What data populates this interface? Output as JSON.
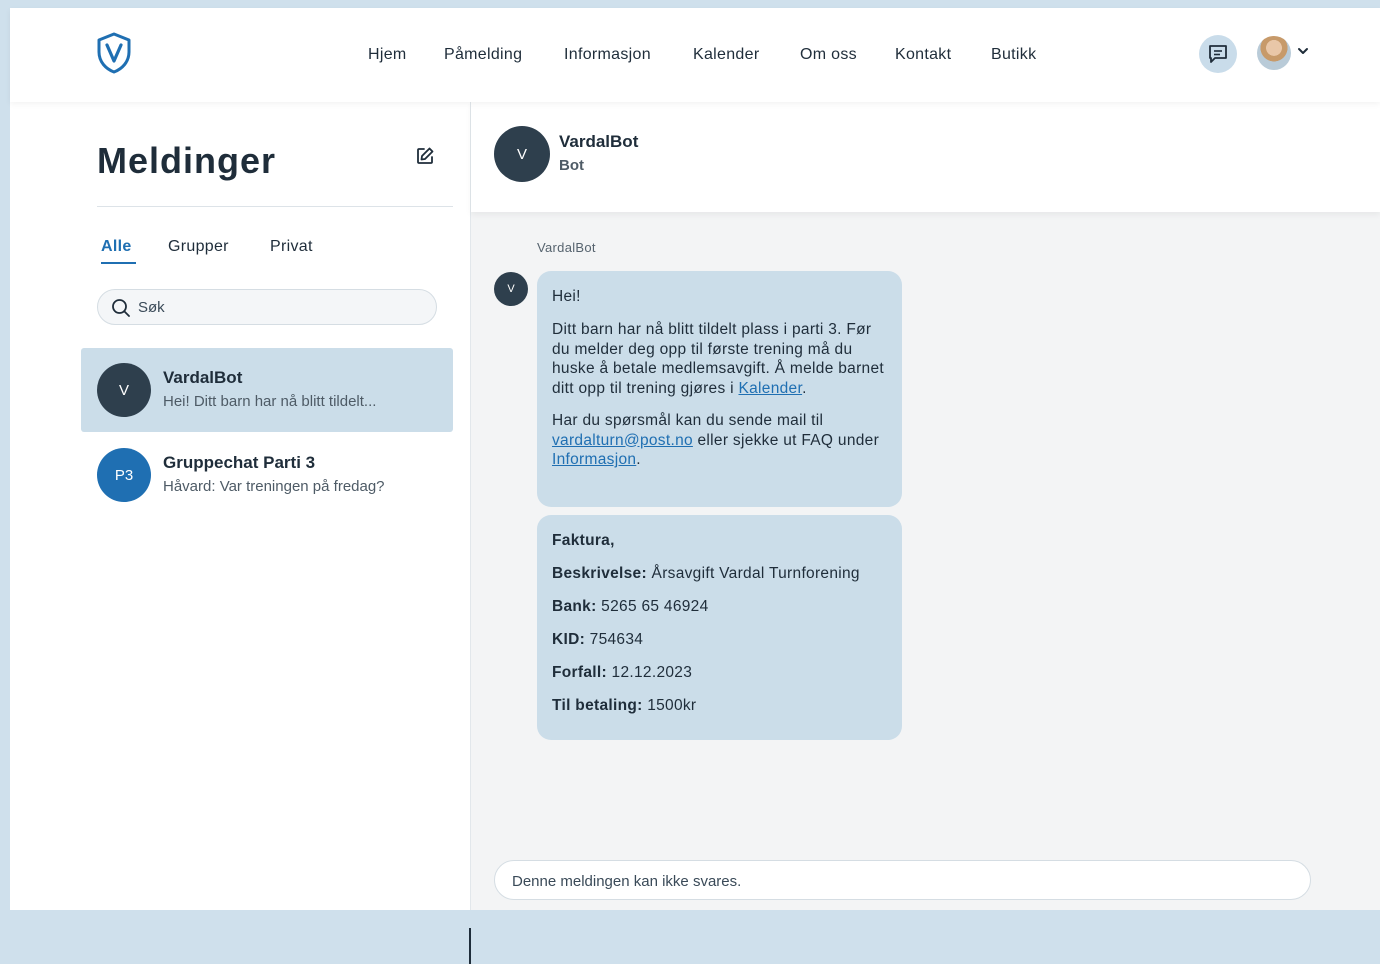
{
  "nav": {
    "logo_icon": "shield-v-logo",
    "items": [
      "Hjem",
      "Påmelding",
      "Informasjon",
      "Kalender",
      "Om oss",
      "Kontakt",
      "Butikk"
    ],
    "messages_icon": "chat-bubble-icon",
    "avatar_icon": "user-avatar",
    "menu_icon": "chevron-down-icon"
  },
  "sidebar": {
    "title": "Meldinger",
    "compose_icon": "edit-icon",
    "tabs": [
      "Alle",
      "Grupper",
      "Privat"
    ],
    "active_tab": "Alle",
    "search_placeholder": "Søk",
    "conversations": [
      {
        "avatar": "V",
        "name": "VardalBot",
        "preview": "Hei! Ditt barn har nå blitt tildelt...",
        "selected": true,
        "avatar_color": "#2e3f4d"
      },
      {
        "avatar": "P3",
        "name": "Gruppechat Parti 3",
        "preview": "Håvard: Var treningen på fredag?",
        "selected": false,
        "avatar_color": "#1f6fb2"
      }
    ]
  },
  "chat": {
    "header_avatar": "V",
    "header_name": "VardalBot",
    "header_sub": "Bot",
    "sender_label": "VardalBot",
    "sender_avatar": "V",
    "message1": {
      "greeting": "Hei!",
      "p1_text": "Ditt barn har nå blitt tildelt plass i parti 3. Før du melder deg opp til første trening må du huske å betale medlemsavgift. Å melde barnet ditt opp til trening gjøres i ",
      "p1_link": "Kalender",
      "p1_end": ".",
      "p2_text": "Har du spørsmål kan du sende mail til ",
      "p2_email": "vardalturn@post.no",
      "p2_mid": " eller sjekke ut FAQ under ",
      "p2_link": "Informasjon",
      "p2_end": "."
    },
    "invoice": {
      "title": "Faktura,",
      "desc_label": "Beskrivelse:",
      "desc_value": " Årsavgift Vardal Turnforening",
      "bank_label": "Bank:",
      "bank_value": " 5265 65 46924",
      "kid_label": "KID:",
      "kid_value": " 754634",
      "due_label": "Forfall:",
      "due_value": " 12.12.2023",
      "total_label": "Til betaling:",
      "total_value": " 1500kr"
    },
    "reply_placeholder": "Denne meldingen kan ikke svares."
  },
  "colors": {
    "accent": "#1f6fb2",
    "bubble": "#cbdde9",
    "dark_avatar": "#2e3f4d",
    "page_bg": "#cfe0ec"
  }
}
